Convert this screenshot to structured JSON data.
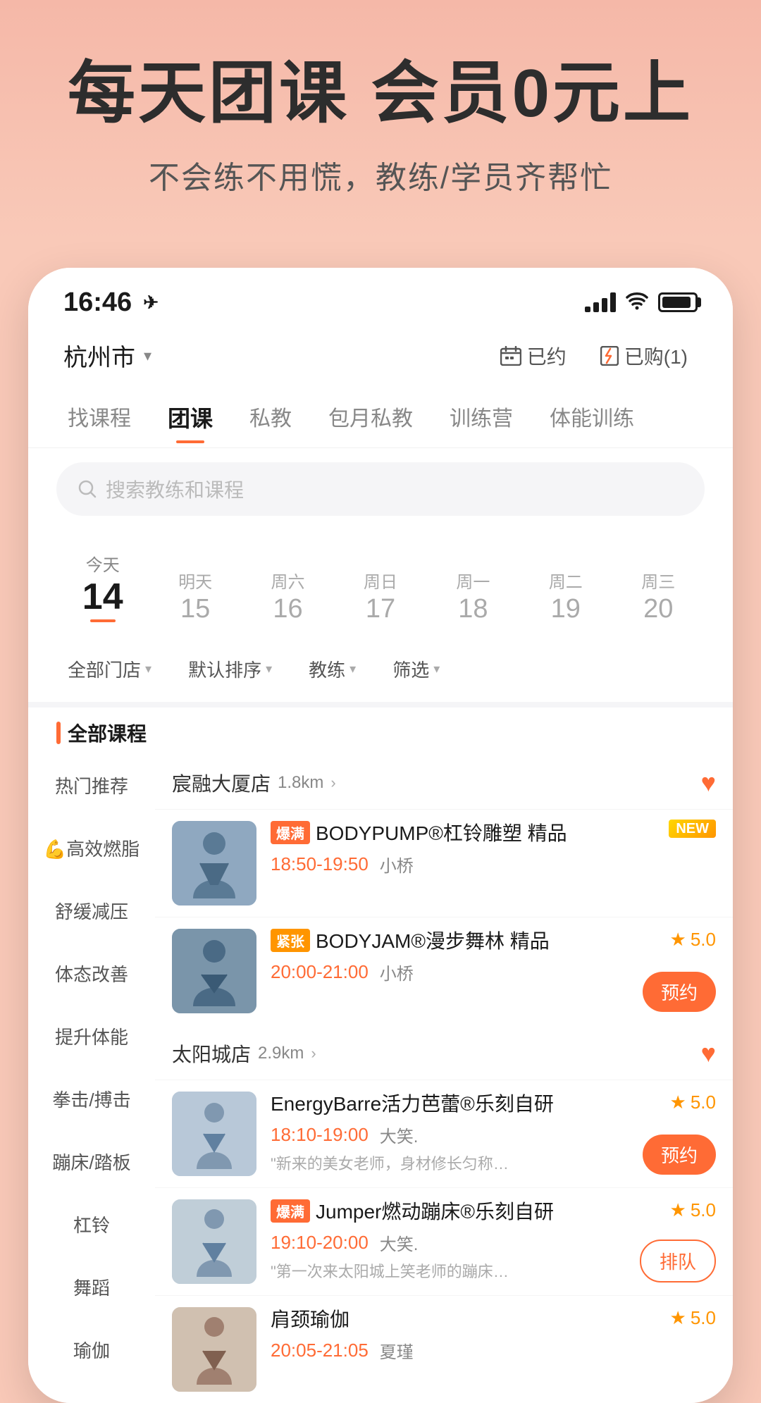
{
  "hero": {
    "title": "每天团课 会员0元上",
    "subtitle": "不会练不用慌，教练/学员齐帮忙"
  },
  "statusBar": {
    "time": "16:46",
    "locationArrow": "➤"
  },
  "header": {
    "location": "杭州市",
    "dropArrow": "▾",
    "booked": "已约",
    "purchased": "已购(1)"
  },
  "navTabs": [
    {
      "label": "找课程",
      "active": false
    },
    {
      "label": "团课",
      "active": true
    },
    {
      "label": "私教",
      "active": false
    },
    {
      "label": "包月私教",
      "active": false
    },
    {
      "label": "训练营",
      "active": false
    },
    {
      "label": "体能训练",
      "active": false
    }
  ],
  "search": {
    "placeholder": "搜索教练和课程"
  },
  "dates": [
    {
      "label": "今天",
      "num": "14",
      "today": true
    },
    {
      "label": "明天",
      "num": "15",
      "today": false
    },
    {
      "label": "周六",
      "num": "16",
      "today": false
    },
    {
      "label": "周日",
      "num": "17",
      "today": false
    },
    {
      "label": "周一",
      "num": "18",
      "today": false
    },
    {
      "label": "周二",
      "num": "19",
      "today": false
    },
    {
      "label": "周三",
      "num": "20",
      "today": false
    }
  ],
  "filters": [
    {
      "label": "全部门店"
    },
    {
      "label": "默认排序"
    },
    {
      "label": "教练"
    },
    {
      "label": "筛选"
    }
  ],
  "allCoursesLabel": "全部课程",
  "categories": [
    {
      "label": "热门推荐",
      "active": false
    },
    {
      "label": "💪高效燃脂",
      "active": false
    },
    {
      "label": "舒缓减压",
      "active": false
    },
    {
      "label": "体态改善",
      "active": false
    },
    {
      "label": "提升体能",
      "active": false
    },
    {
      "label": "拳击/搏击",
      "active": false
    },
    {
      "label": "蹦床/踏板",
      "active": false
    },
    {
      "label": "杠铃",
      "active": false
    },
    {
      "label": "舞蹈",
      "active": false
    },
    {
      "label": "瑜伽",
      "active": false
    }
  ],
  "stores": [
    {
      "name": "宸融大厦店",
      "distance": "1.8km",
      "favorited": true,
      "courses": [
        {
          "tag": "爆满",
          "tagType": "full",
          "tagNew": true,
          "name": "BODYPUMP®杠铃雕塑 精品",
          "time": "18:50-19:50",
          "teacher": "小桥",
          "rating": null,
          "hasBook": false,
          "hasQueue": false,
          "desc": ""
        },
        {
          "tag": "紧张",
          "tagType": "tight",
          "tagNew": false,
          "name": "BODYJAM®漫步舞林 精品",
          "time": "20:00-21:00",
          "teacher": "小桥",
          "rating": "5.0",
          "hasBook": true,
          "hasQueue": false,
          "desc": ""
        }
      ]
    },
    {
      "name": "太阳城店",
      "distance": "2.9km",
      "favorited": true,
      "courses": [
        {
          "tag": null,
          "tagType": null,
          "tagNew": false,
          "name": "EnergyBarre活力芭蕾®乐刻自研",
          "time": "18:10-19:00",
          "teacher": "大笑.",
          "rating": "5.0",
          "hasBook": true,
          "hasQueue": false,
          "desc": "\"新来的美女老师，身材修长匀称，教..."
        },
        {
          "tag": "爆满",
          "tagType": "full",
          "tagNew": false,
          "name": "Jumper燃动蹦床®乐刻自研",
          "time": "19:10-20:00",
          "teacher": "大笑.",
          "rating": "5.0",
          "hasBook": false,
          "hasQueue": true,
          "desc": "\"第一次来太阳城上笑老师的蹦床课..."
        },
        {
          "tag": null,
          "tagType": null,
          "tagNew": false,
          "name": "肩颈瑜伽",
          "time": "20:05-21:05",
          "teacher": "夏瑾",
          "rating": "5.0",
          "hasBook": false,
          "hasQueue": false,
          "desc": ""
        }
      ]
    }
  ]
}
